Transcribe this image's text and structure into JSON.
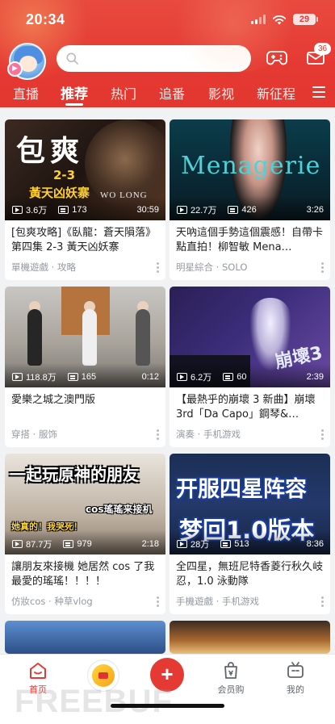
{
  "status_bar": {
    "time": "20:34",
    "battery": "29"
  },
  "header": {
    "search_placeholder": "",
    "mail_badge": "36",
    "tabs": [
      {
        "label": "直播"
      },
      {
        "label": "推荐",
        "active": true
      },
      {
        "label": "热门"
      },
      {
        "label": "追番"
      },
      {
        "label": "影视"
      },
      {
        "label": "新征程"
      }
    ]
  },
  "thumb_text": {
    "c1_big": "包爽",
    "c1_sub1": "2-3",
    "c1_sub2": "黃天凶妖寨",
    "c1_logo": "WO LONG",
    "c2_word": "Menagerie",
    "c5_l1": "一起玩原神的朋友",
    "c5_l2": "cos瑤瑤来接机",
    "c5_l3": "她真的！我哭死！",
    "c6_l1": "开服四星阵容",
    "c6_l2": "梦回1.0版本"
  },
  "feed": {
    "cards": [
      {
        "views": "3.6万",
        "danmaku": "173",
        "duration": "30:59",
        "title": "[包爽攻略]《臥龍：蒼天隕落》第四集 2-3 黃天凶妖寨",
        "tag": "單機遊戲 · 攻略"
      },
      {
        "views": "22.7万",
        "danmaku": "426",
        "duration": "3:26",
        "title": "天吶這個手勢這個震感！自帶卡點直拍！柳智敏 Mena…",
        "tag": "明星綜合 · SOLO"
      },
      {
        "views": "118.8万",
        "danmaku": "165",
        "duration": "0:12",
        "title": "愛樂之城之澳門版",
        "tag": "穿搭 · 服饰"
      },
      {
        "views": "6.2万",
        "danmaku": "60",
        "duration": "2:39",
        "title": "【最熱乎的崩壞 3 新曲】崩壞 3rd「Da Capo」鋼琴&…",
        "tag": "演奏 · 手机游戏"
      },
      {
        "views": "87.7万",
        "danmaku": "979",
        "duration": "2:18",
        "title": "讓朋友來接機 她居然 cos 了我最愛的瑤瑤！！！！",
        "tag": "仿妝cos · 种草vlog"
      },
      {
        "views": "28万",
        "danmaku": "513",
        "duration": "8:36",
        "title": "全四星，無班尼特香菱行秋久岐忍，1.0 泳動隊",
        "tag": "手機遊戲 · 手机游戏"
      }
    ]
  },
  "bottom_nav": {
    "home": "首页",
    "membership": "会员购",
    "mine": "我的"
  },
  "watermark": "FREEBUF",
  "colors": {
    "brand": "#e53a33",
    "text": "#212121",
    "muted": "#9499a0"
  }
}
